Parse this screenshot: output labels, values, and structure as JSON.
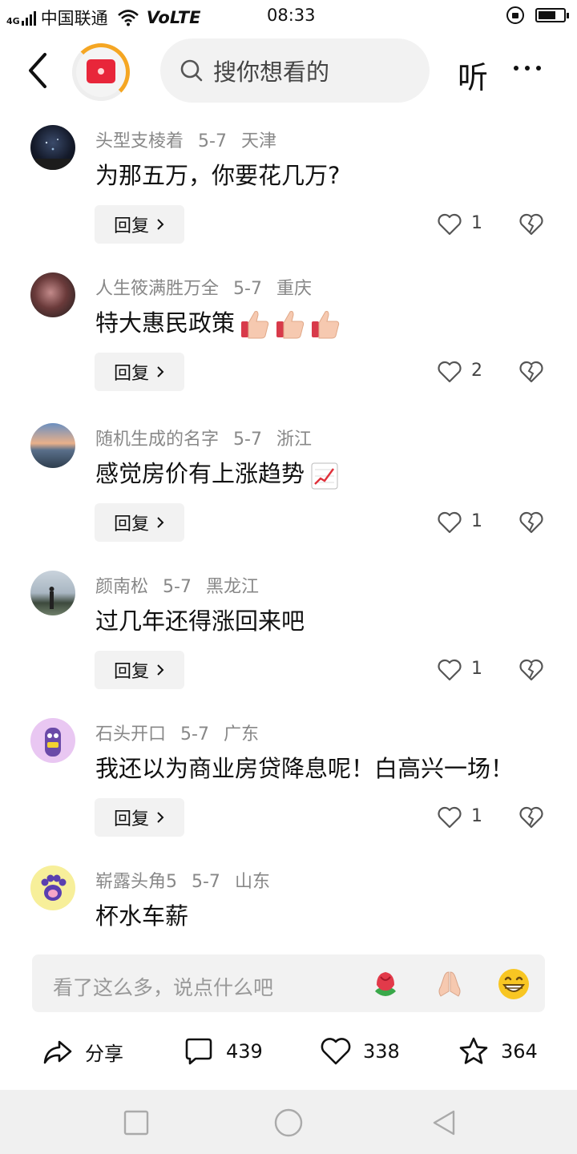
{
  "status_bar": {
    "signal_label": "4G",
    "carrier": "中国联通",
    "volte": "VoLTE",
    "time": "08:33",
    "battery_level": 0.7
  },
  "header": {
    "search_placeholder": "搜你想看的",
    "listen_label": "听"
  },
  "comments": [
    {
      "user": "头型支棱着",
      "date": "5-7",
      "location": "天津",
      "text": "为那五万，你要花几万?",
      "reply_label": "回复",
      "likes": "1"
    },
    {
      "user": "人生筱满胜万全",
      "date": "5-7",
      "location": "重庆",
      "text": "特大惠民政策",
      "reply_label": "回复",
      "likes": "2"
    },
    {
      "user": "随机生成的名字",
      "date": "5-7",
      "location": "浙江",
      "text": "感觉房价有上涨趋势",
      "reply_label": "回复",
      "likes": "1"
    },
    {
      "user": "颜南松",
      "date": "5-7",
      "location": "黑龙江",
      "text": "过几年还得涨回来吧",
      "reply_label": "回复",
      "likes": "1"
    },
    {
      "user": "石头开口",
      "date": "5-7",
      "location": "广东",
      "text": "我还以为商业房贷降息呢！白高兴一场！",
      "reply_label": "回复",
      "likes": "1"
    },
    {
      "user": "崭露头角5",
      "date": "5-7",
      "location": "山东",
      "text": "杯水车薪"
    }
  ],
  "input_bar": {
    "placeholder": "看了这么多，说点什么吧",
    "quick_emojis": [
      "rose-icon",
      "pray-icon",
      "grin-icon"
    ]
  },
  "actions": {
    "share_label": "分享",
    "comments_count": "439",
    "likes_count": "338",
    "favorites_count": "364"
  },
  "colors": {
    "accent": "#f5a623",
    "logo_red": "#e8263a"
  }
}
